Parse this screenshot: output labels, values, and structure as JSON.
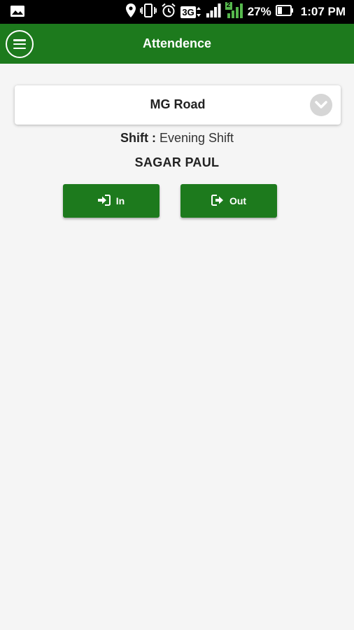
{
  "status_bar": {
    "battery": "27%",
    "time": "1:07 PM",
    "network_type": "3G",
    "sim_slot": "2",
    "icons": [
      "image-icon",
      "location-icon",
      "vibrate-icon",
      "alarm-icon",
      "network-3g-icon",
      "signal-icon",
      "signal-sim2-icon",
      "battery-icon"
    ]
  },
  "app_bar": {
    "title": "Attendence",
    "menu_icon": "menu-icon",
    "color": "#1d7a1d"
  },
  "location_select": {
    "selected": "MG Road",
    "icon": "chevron-down-icon"
  },
  "shift": {
    "label": "Shift :",
    "value": "Evening Shift"
  },
  "employee": {
    "name": "SAGAR PAUL"
  },
  "actions": {
    "in_label": "In",
    "in_icon": "sign-in-icon",
    "out_label": "Out",
    "out_icon": "sign-out-icon"
  }
}
